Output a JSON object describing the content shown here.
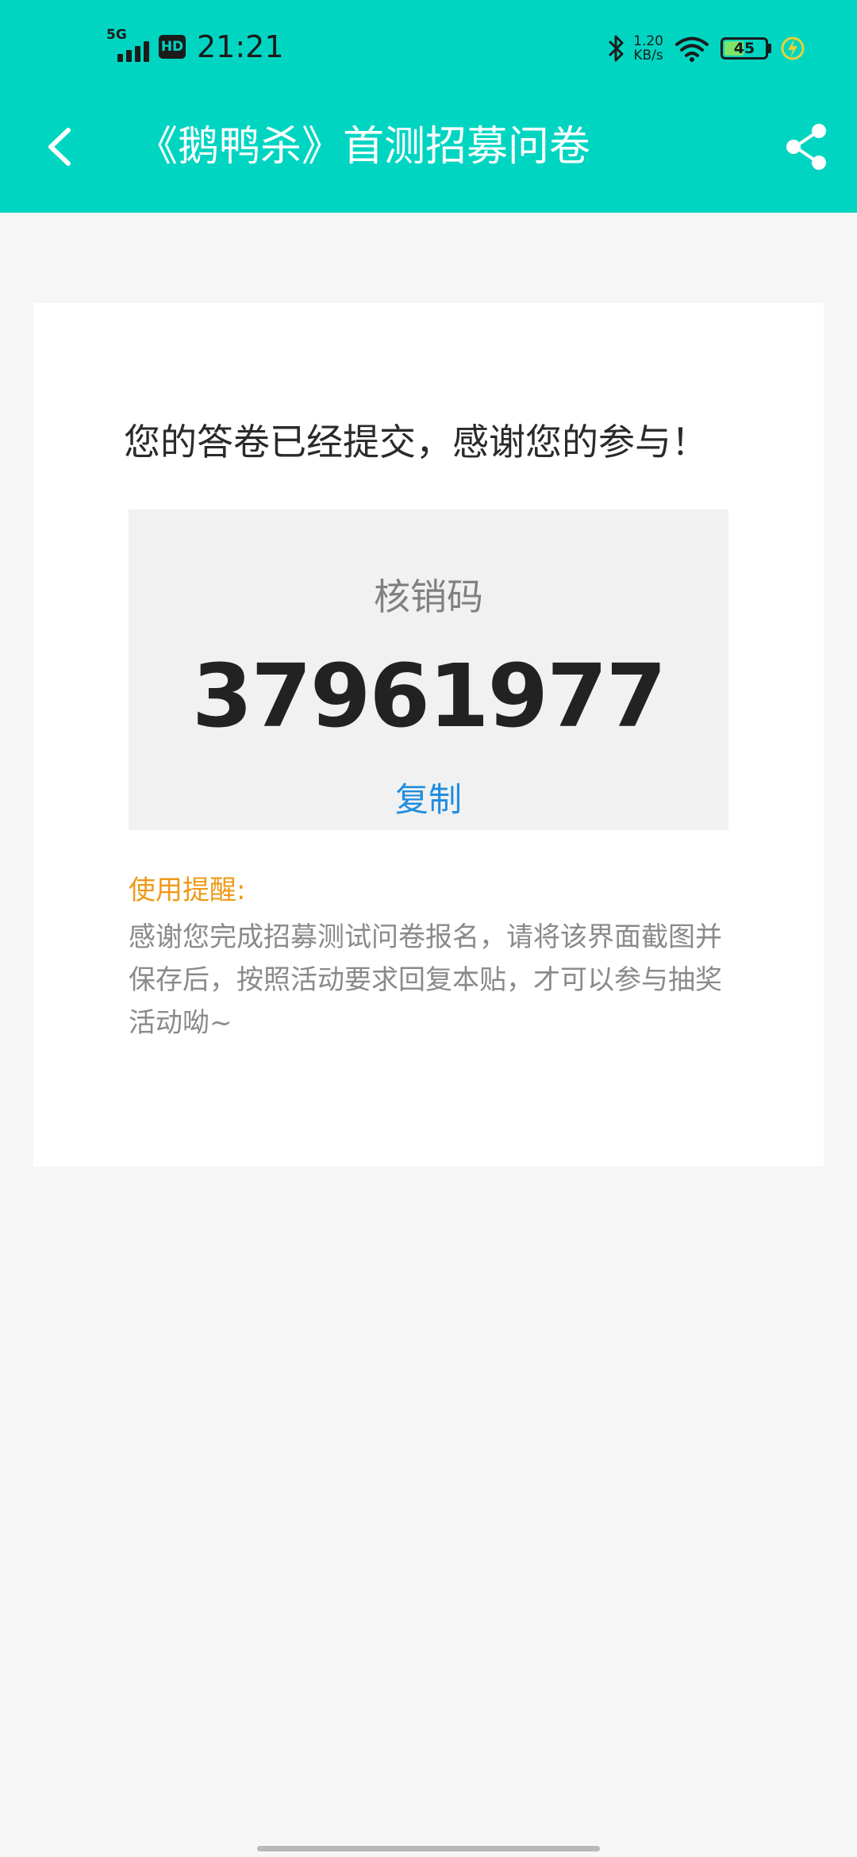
{
  "status_bar": {
    "network": "5G",
    "hd_badge": "HD",
    "time": "21:21",
    "speed_value": "1.20",
    "speed_unit": "KB/s",
    "battery_level": "45",
    "battery_fraction": 0.45
  },
  "nav": {
    "title": "《鹅鸭杀》首测招募问卷"
  },
  "content": {
    "thanks_text": "您的答卷已经提交，感谢您的参与！",
    "code_label": "核销码",
    "code_value": "37961977",
    "copy_label": "复制",
    "tip_title": "使用提醒:",
    "tip_body": "感谢您完成招募测试问卷报名，请将该界面截图并保存后，按照活动要求回复本贴，才可以参与抽奖活动呦~"
  },
  "colors": {
    "accent": "#00d5c2",
    "copy_link": "#1f8de0",
    "tip_title": "#ee9a1a"
  }
}
